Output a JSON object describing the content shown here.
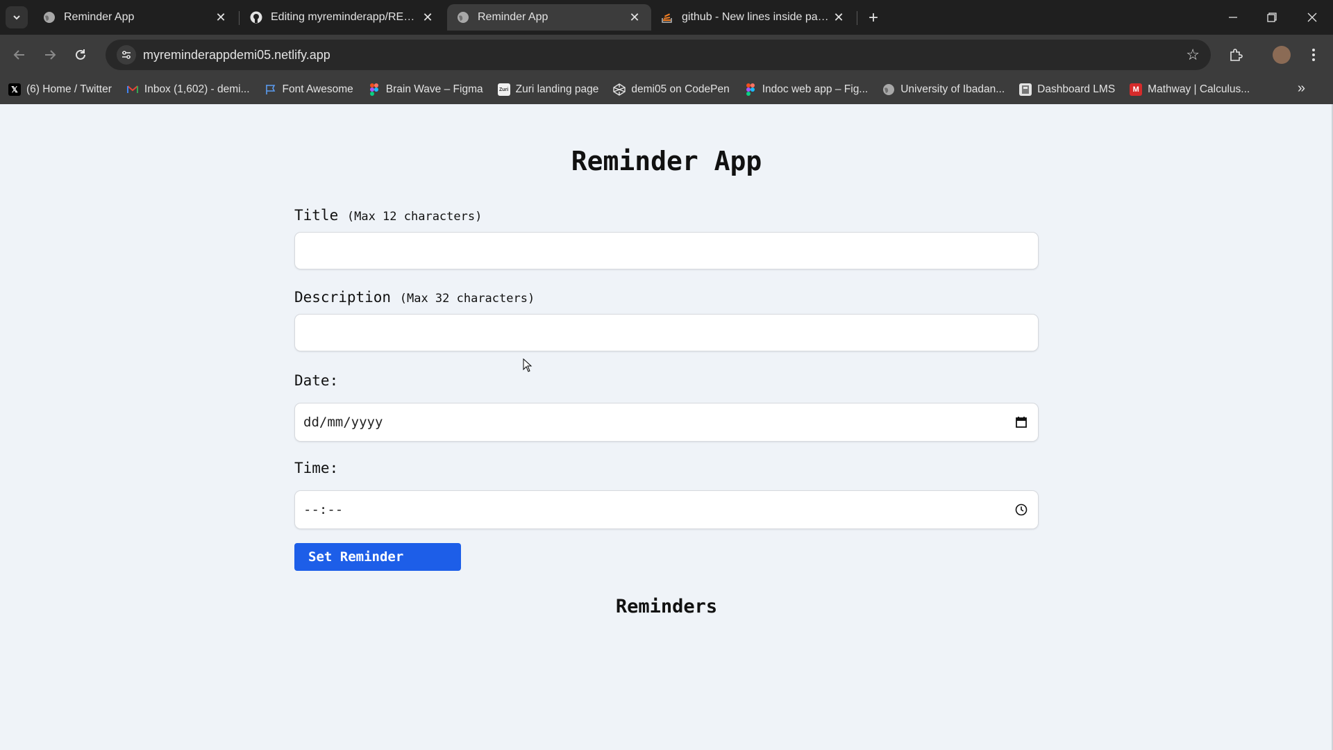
{
  "browser": {
    "tabs": [
      {
        "title": "Reminder App",
        "icon": "globe-icon",
        "active": false
      },
      {
        "title": "Editing myreminderapp/README.md",
        "icon": "github-icon",
        "active": false
      },
      {
        "title": "Reminder App",
        "icon": "globe-icon",
        "active": true
      },
      {
        "title": "github - New lines inside paragraph",
        "icon": "stackoverflow-icon",
        "active": false
      }
    ],
    "new_tab_label": "+",
    "url": "myreminderappdemi05.netlify.app",
    "bookmarks": [
      {
        "label": "(6) Home / Twitter",
        "icon": "x-icon"
      },
      {
        "label": "Inbox (1,602) - demi...",
        "icon": "gmail-icon"
      },
      {
        "label": "Font Awesome",
        "icon": "flag-icon"
      },
      {
        "label": "Brain Wave – Figma",
        "icon": "figma-icon"
      },
      {
        "label": "Zuri landing page",
        "icon": "zuri-icon"
      },
      {
        "label": "demi05 on CodePen",
        "icon": "codepen-icon"
      },
      {
        "label": "Indoc web app – Fig...",
        "icon": "figma-icon"
      },
      {
        "label": "University of Ibadan...",
        "icon": "globe-icon"
      },
      {
        "label": "Dashboard LMS",
        "icon": "lms-icon"
      },
      {
        "label": "Mathway | Calculus...",
        "icon": "mathway-icon"
      }
    ]
  },
  "app": {
    "title": "Reminder App",
    "title_field": {
      "label": "Title",
      "hint": "(Max 12 characters)",
      "value": ""
    },
    "description_field": {
      "label": "Description",
      "hint": "(Max 32 characters)",
      "value": ""
    },
    "date_field": {
      "label": "Date:",
      "placeholder": "dd/mm/yyyy"
    },
    "time_field": {
      "label": "Time:",
      "placeholder": "--:--"
    },
    "submit_label": "Set Reminder",
    "reminders_heading": "Reminders"
  },
  "colors": {
    "page_bg": "#eff3f8",
    "button_bg": "#1d5ee8",
    "chrome_dark": "#1f1f1f",
    "chrome_toolbar": "#3c3c3c"
  }
}
